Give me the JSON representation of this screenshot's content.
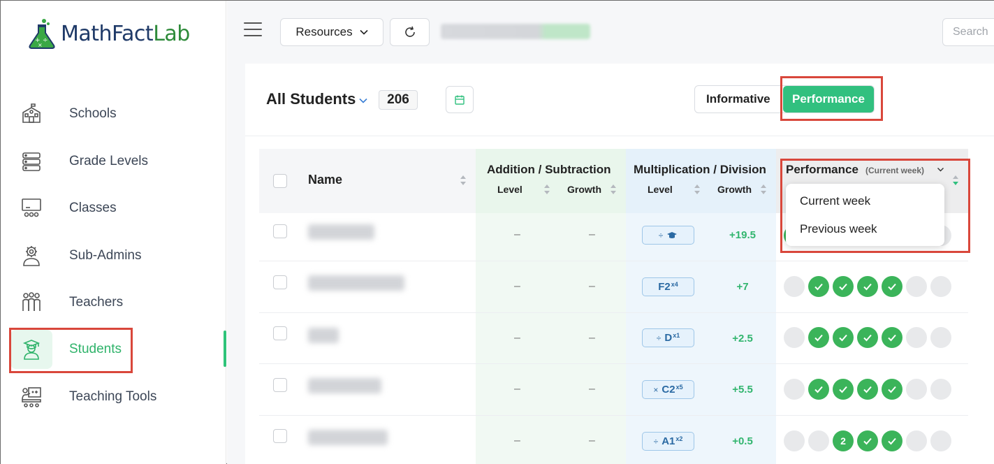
{
  "app": {
    "logo_main": "MathFact",
    "logo_accent": "Lab"
  },
  "sidebar": {
    "items": [
      {
        "label": "Schools",
        "icon": "school-icon"
      },
      {
        "label": "Grade Levels",
        "icon": "layers-icon"
      },
      {
        "label": "Classes",
        "icon": "classroom-icon"
      },
      {
        "label": "Sub-Admins",
        "icon": "admin-icon"
      },
      {
        "label": "Teachers",
        "icon": "teachers-icon"
      },
      {
        "label": "Students",
        "icon": "student-icon",
        "active": true
      },
      {
        "label": "Teaching Tools",
        "icon": "tools-icon"
      }
    ]
  },
  "topbar": {
    "resources_label": "Resources",
    "search_placeholder": "Search"
  },
  "header": {
    "title": "All Students",
    "count": "206",
    "view_informative": "Informative",
    "view_performance": "Performance",
    "active_view": "Performance"
  },
  "table": {
    "name_header": "Name",
    "add_sub_header": "Addition / Subtraction",
    "mul_div_header": "Multiplication / Division",
    "level_label": "Level",
    "growth_label": "Growth",
    "performance_header": "Performance",
    "performance_period": "(Current week)",
    "rows": [
      {
        "add_level": "–",
        "add_growth": "–",
        "mul_op": "÷",
        "mul_level": "",
        "mul_sup": "",
        "mul_growth": "+19.5",
        "dots": [
          "on",
          "off",
          "off",
          "off",
          "off",
          "off",
          "off"
        ]
      },
      {
        "add_level": "–",
        "add_growth": "–",
        "mul_op": "",
        "mul_level": "F2",
        "mul_sup": "x4",
        "mul_growth": "+7",
        "dots": [
          "off",
          "on",
          "on",
          "on",
          "on",
          "off",
          "off"
        ]
      },
      {
        "add_level": "–",
        "add_growth": "–",
        "mul_op": "÷",
        "mul_level": "D",
        "mul_sup": "x1",
        "mul_growth": "+2.5",
        "dots": [
          "off",
          "on",
          "on",
          "on",
          "on",
          "off",
          "off"
        ]
      },
      {
        "add_level": "–",
        "add_growth": "–",
        "mul_op": "×",
        "mul_level": "C2",
        "mul_sup": "x5",
        "mul_growth": "+5.5",
        "dots": [
          "off",
          "on",
          "on",
          "on",
          "on",
          "off",
          "off"
        ]
      },
      {
        "add_level": "–",
        "add_growth": "–",
        "mul_op": "÷",
        "mul_level": "A1",
        "mul_sup": "x2",
        "mul_growth": "+0.5",
        "dots": [
          "off",
          "off",
          "2",
          "on",
          "on",
          "off",
          "off"
        ]
      }
    ]
  },
  "dropdown": {
    "options": [
      "Current week",
      "Previous week"
    ]
  },
  "colors": {
    "accent_green": "#31c07f",
    "highlight_red": "#d9473b",
    "check_green": "#3bb45a",
    "brand_navy": "#1f3a68"
  }
}
